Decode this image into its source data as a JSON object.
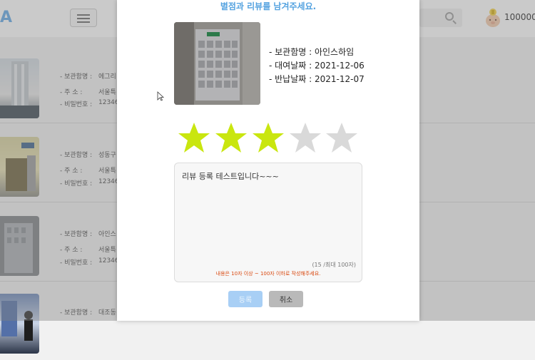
{
  "header": {
    "logo": "A",
    "points": "100000"
  },
  "list": {
    "items": [
      {
        "storage_label": "- 보관함명 :",
        "storage_name": "에그리",
        "address_label": "- 주      소 :",
        "address": "서울특",
        "password_label": "- 비밀번호 :",
        "password": "12346"
      },
      {
        "storage_label": "- 보관함명 :",
        "storage_name": "성동구",
        "address_label": "- 주      소 :",
        "address": "서울특",
        "password_label": "- 비밀번호 :",
        "password": "12346"
      },
      {
        "storage_label": "- 보관함명 :",
        "storage_name": "아인스",
        "address_label": "- 주      소 :",
        "address": "서울특",
        "password_label": "- 비밀번호 :",
        "password": "12346"
      },
      {
        "storage_label": "- 보관함명 :",
        "storage_name": "대조동"
      }
    ]
  },
  "modal": {
    "title": "별점과 리뷰를 남겨주세요.",
    "storage_line": "- 보관함명 : 아인스하임",
    "rental_date_line": "- 대여날짜 : 2021-12-06",
    "return_date_line": "- 반납날짜 : 2021-12-07",
    "rating": 3,
    "rating_max": 5,
    "review_text": "리뷰 등록 테스트입니다~~~",
    "char_count": "(15 /최대 100자)",
    "hint": "내용은 10자 이상 ~ 100자 이하로 작성해주세요.",
    "submit_label": "등록",
    "cancel_label": "취소"
  },
  "colors": {
    "accent": "#55a3e0",
    "star_on": "#c9e60f",
    "star_off": "#d9d9d9",
    "hint": "#d9480f"
  },
  "icons": [
    "menu-icon",
    "search-icon",
    "piggy-bank-icon",
    "star-icon",
    "mouse-cursor-icon"
  ]
}
